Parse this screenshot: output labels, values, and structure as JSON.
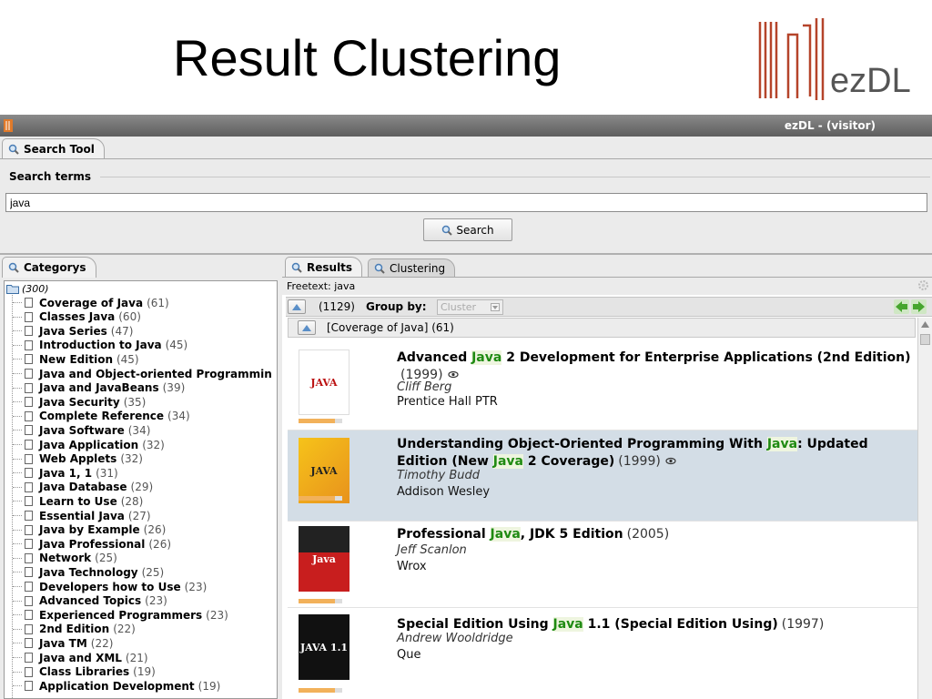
{
  "slide": {
    "title": "Result Clustering",
    "logo_text": "ezDL"
  },
  "window": {
    "title": "ezDL - (visitor)"
  },
  "search_tool": {
    "tab_label": "Search Tool",
    "section_label": "Search terms",
    "query_value": "java",
    "search_button": "Search"
  },
  "categories": {
    "tab_label": "Categorys",
    "root_count": "(300)",
    "items": [
      {
        "name": "Coverage of Java",
        "count": "(61)"
      },
      {
        "name": "Classes Java",
        "count": "(60)"
      },
      {
        "name": "Java Series",
        "count": "(47)"
      },
      {
        "name": "Introduction to Java",
        "count": "(45)"
      },
      {
        "name": "New Edition",
        "count": "(45)"
      },
      {
        "name": "Java and Object-oriented Programmin",
        "count": ""
      },
      {
        "name": "Java and JavaBeans",
        "count": "(39)"
      },
      {
        "name": "Java Security",
        "count": "(35)"
      },
      {
        "name": "Complete Reference",
        "count": "(34)"
      },
      {
        "name": "Java Software",
        "count": "(34)"
      },
      {
        "name": "Java Application",
        "count": "(32)"
      },
      {
        "name": "Web Applets",
        "count": "(32)"
      },
      {
        "name": "Java 1, 1",
        "count": "(31)"
      },
      {
        "name": "Java Database",
        "count": "(29)"
      },
      {
        "name": "Learn to Use",
        "count": "(28)"
      },
      {
        "name": "Essential Java",
        "count": "(27)"
      },
      {
        "name": "Java by Example",
        "count": "(26)"
      },
      {
        "name": "Java Professional",
        "count": "(26)"
      },
      {
        "name": "Network",
        "count": "(25)"
      },
      {
        "name": "Java Technology",
        "count": "(25)"
      },
      {
        "name": "Developers how to Use",
        "count": "(23)"
      },
      {
        "name": "Advanced Topics",
        "count": "(23)"
      },
      {
        "name": "Experienced Programmers",
        "count": "(23)"
      },
      {
        "name": "2nd Edition",
        "count": "(22)"
      },
      {
        "name": "Java TM",
        "count": "(22)"
      },
      {
        "name": "Java and XML",
        "count": "(21)"
      },
      {
        "name": "Class Libraries",
        "count": "(19)"
      },
      {
        "name": "Application Development",
        "count": "(19)"
      }
    ]
  },
  "results": {
    "tab_results": "Results",
    "tab_clustering": "Clustering",
    "freetext": "Freetext: java",
    "total": "(1129)",
    "group_by_label": "Group by:",
    "group_by_value": "Cluster",
    "group_header": "[Coverage of Java] (61)",
    "items": [
      {
        "title_parts": [
          "Advanced ",
          "Java",
          " 2 Development for Enterprise Applications (2nd Edition)"
        ],
        "year": "(1999)",
        "author": "Cliff Berg",
        "publisher": "Prentice Hall PTR",
        "relevance": 0.83,
        "selected": false,
        "cover_text": "JAVA"
      },
      {
        "title_parts": [
          "Understanding Object-Oriented Programming With ",
          "Java",
          ": Updated Edition (New ",
          "Java",
          " 2 Coverage)"
        ],
        "year": "(1999)",
        "author": "Timothy Budd",
        "publisher": "Addison Wesley",
        "relevance": 0.83,
        "selected": true,
        "cover_text": "JAVA"
      },
      {
        "title_parts": [
          "Professional ",
          "Java",
          ", JDK 5 Edition"
        ],
        "year": "(2005)",
        "author": "Jeff Scanlon",
        "publisher": "Wrox",
        "relevance": 0.83,
        "selected": false,
        "cover_text": "Java"
      },
      {
        "title_parts": [
          "Special Edition Using ",
          "Java",
          " 1.1 (Special Edition Using)"
        ],
        "year": "(1997)",
        "author": "Andrew Wooldridge",
        "publisher": "Que",
        "relevance": 0.83,
        "selected": false,
        "cover_text": "JAVA 1.1"
      }
    ]
  },
  "colors": {
    "highlight": "#1f8a12",
    "selected_row": "#d3dde6",
    "relevance_bar": "#f2b15a",
    "logo": "#b5442a"
  }
}
